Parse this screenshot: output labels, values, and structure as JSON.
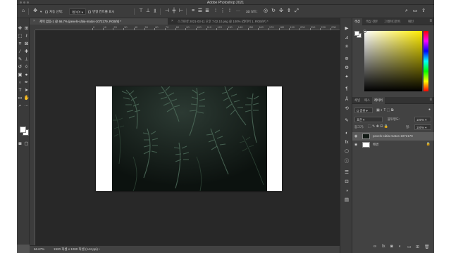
{
  "app": {
    "title": "Adobe Photoshop 2021"
  },
  "options_bar": {
    "auto_select_label": "자동 선택:",
    "auto_select_value": "레이어",
    "show_transform_label": "변형 컨트롤 표시",
    "more_label": "···",
    "mode_3d_label": "3D 모드:"
  },
  "tabs": [
    {
      "label": "제목 없음-1 @ 66.7% (pexels-cátia-matos-1072179, RGB/8) *",
      "active": true
    },
    {
      "label": "스크린샷 2021-03-11 오후 7.02.10.png @ 100% (레이어 1, RGB/8*) *",
      "active": false
    }
  ],
  "ruler": {
    "labels": [
      "0",
      "10",
      "20",
      "30",
      "40",
      "50",
      "60",
      "70",
      "80",
      "90",
      "100",
      "110",
      "120",
      "130",
      "140",
      "150",
      "160",
      "170",
      "180",
      "190",
      "200",
      "210",
      "220",
      "230",
      "240"
    ]
  },
  "status": {
    "zoom": "66.67%",
    "doc_info": "1920 픽셀 x 1080 픽셀 (144 ppi)"
  },
  "color_panel": {
    "tabs": [
      "색상",
      "색상 견본",
      "그레이디언트",
      "패턴"
    ]
  },
  "layers_panel": {
    "tabs": [
      "채널",
      "패스",
      "레이어"
    ],
    "filter_label": "Q 종류",
    "blend_mode": "표준",
    "opacity_label": "불투명도:",
    "opacity_value": "100%",
    "lock_label": "잠그기:",
    "fill_label": "칠:",
    "fill_value": "100%",
    "layers": [
      {
        "name": "pexels-cátia-matos-1072179",
        "selected": true,
        "locked": false
      },
      {
        "name": "배경",
        "selected": false,
        "locked": true
      }
    ]
  },
  "icons": {
    "home": "⌂",
    "move": "✥",
    "search": "⌕",
    "window": "▭",
    "share": "⇪",
    "panel_menu": "≡"
  },
  "colors": {
    "foreground": "#ffffff",
    "background": "#ffffff",
    "canvas_bg": "#282828",
    "ui_bg": "#535353"
  }
}
